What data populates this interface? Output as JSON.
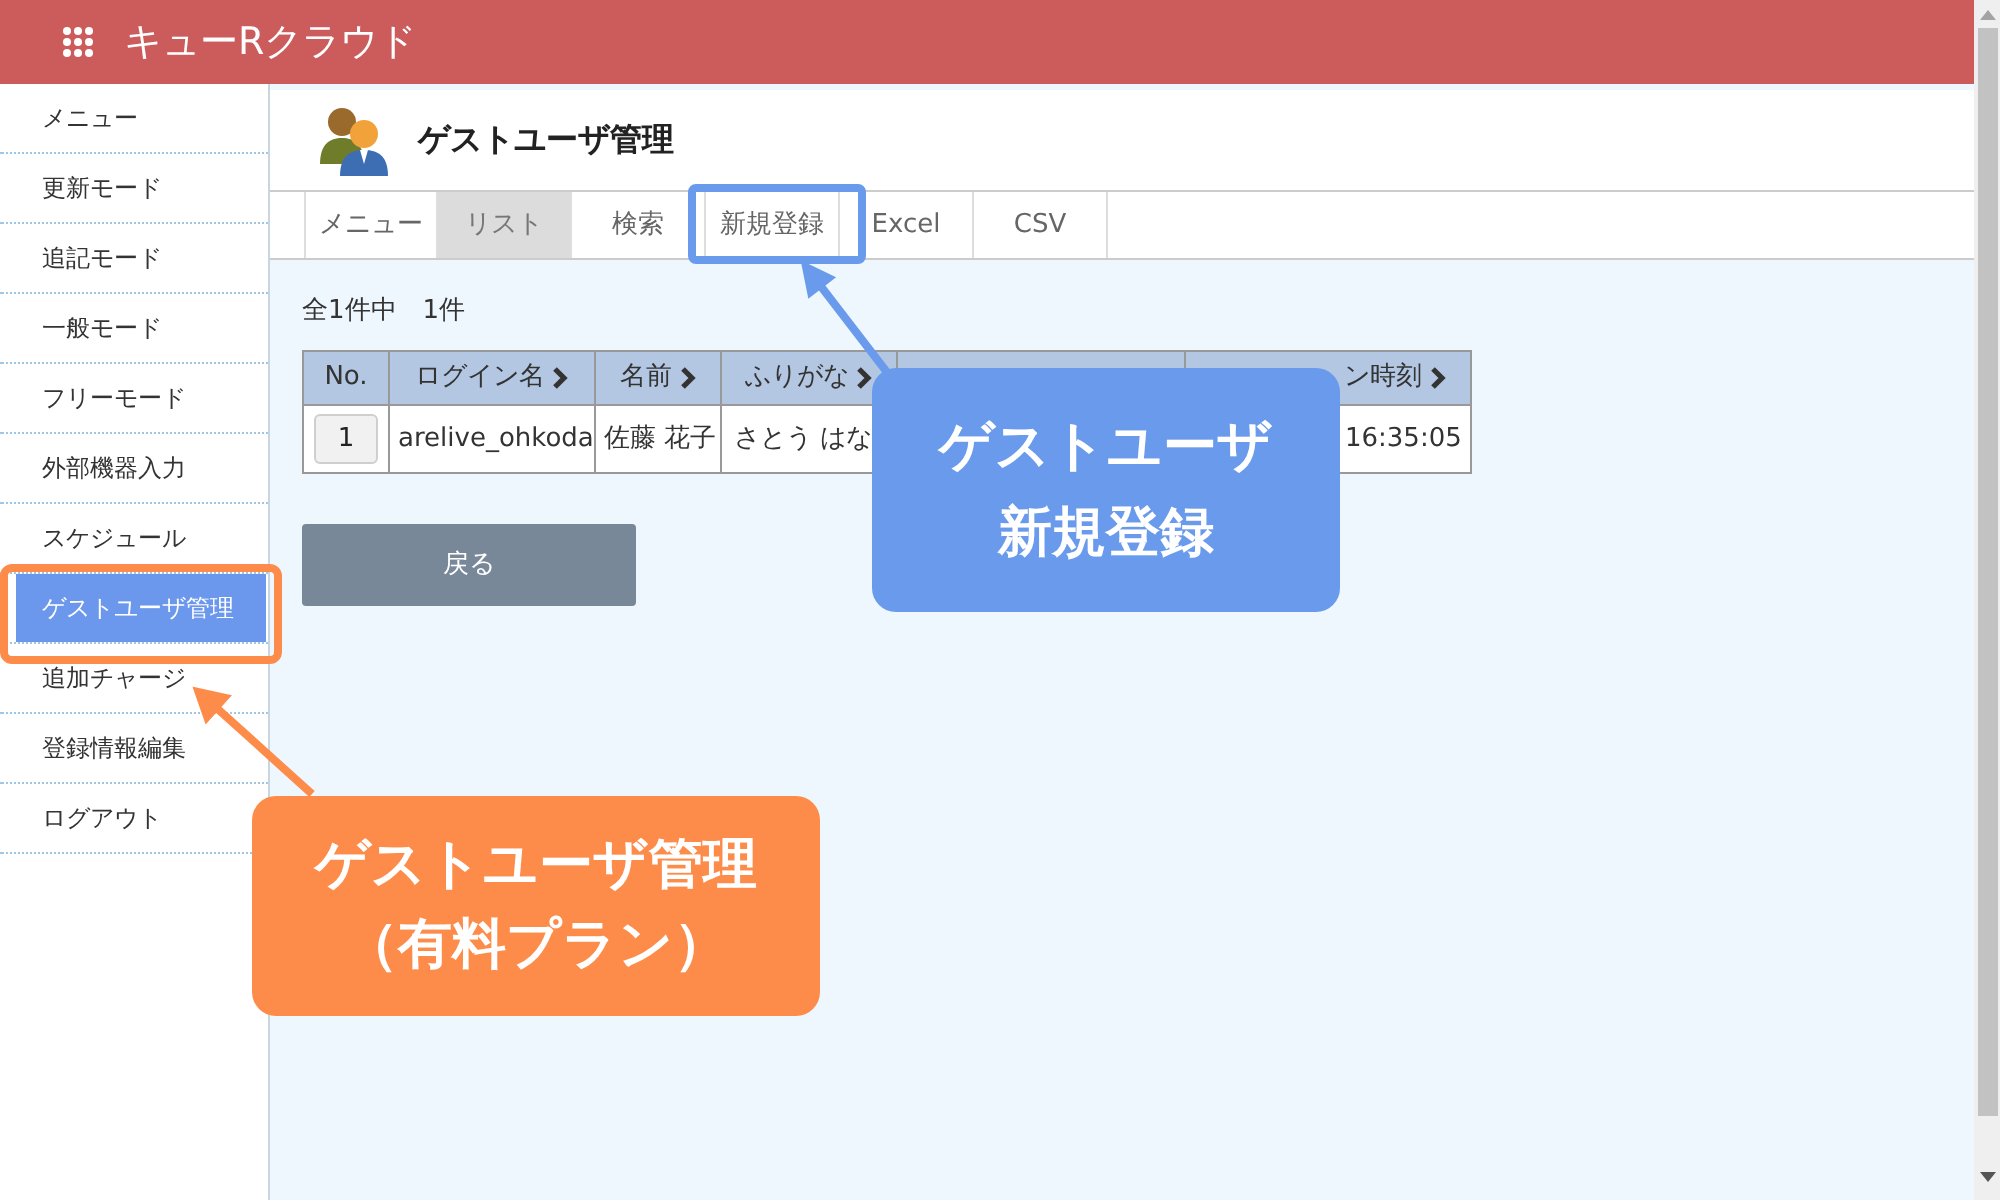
{
  "header": {
    "app_title": "キューRクラウド"
  },
  "sidebar": {
    "items": [
      {
        "label": "メニュー",
        "selected": false
      },
      {
        "label": "更新モード",
        "selected": false
      },
      {
        "label": "追記モード",
        "selected": false
      },
      {
        "label": "一般モード",
        "selected": false
      },
      {
        "label": "フリーモード",
        "selected": false
      },
      {
        "label": "外部機器入力",
        "selected": false
      },
      {
        "label": "スケジュール",
        "selected": false
      },
      {
        "label": "ゲストユーザ管理",
        "selected": true
      },
      {
        "label": "追加チャージ",
        "selected": false
      },
      {
        "label": "登録情報編集",
        "selected": false
      },
      {
        "label": "ログアウト",
        "selected": false
      }
    ]
  },
  "page": {
    "title": "ゲストユーザ管理"
  },
  "tabs": [
    {
      "label": "メニュー",
      "selected": false
    },
    {
      "label": "リスト",
      "selected": true
    },
    {
      "label": "検索",
      "selected": false
    },
    {
      "label": "新規登録",
      "selected": false
    },
    {
      "label": "Excel",
      "selected": false
    },
    {
      "label": "CSV",
      "selected": false
    }
  ],
  "summary": "全1件中　1件",
  "table": {
    "columns": [
      {
        "label": "No.",
        "sortable": false
      },
      {
        "label": "ログイン名",
        "sortable": true
      },
      {
        "label": "名前",
        "sortable": true
      },
      {
        "label": "ふりがな",
        "sortable": true
      },
      {},
      {
        "label": "ン時刻",
        "sortable": true
      }
    ],
    "rows": [
      {
        "cells": [
          "1",
          "arelive_ohkoda",
          "佐藤 花子",
          "さとう はな",
          null,
          "16:35:05"
        ]
      }
    ]
  },
  "back_button": "戻る",
  "annotations": [
    {
      "lines": [
        "ゲストユーザ",
        "新規登録"
      ],
      "color": "#6a9aeb"
    },
    {
      "lines": [
        "ゲストユーザ管理",
        "（有料プラン）"
      ],
      "color": "#fd8c4a"
    }
  ]
}
